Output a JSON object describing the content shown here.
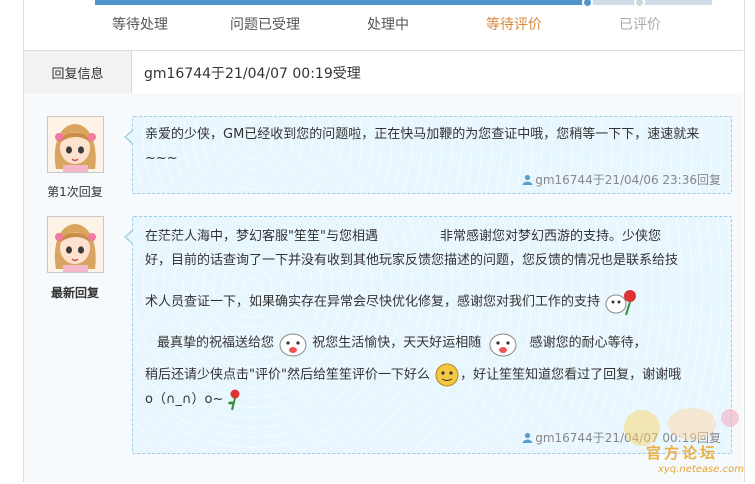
{
  "steps": [
    {
      "label": "等待处理",
      "state": "done"
    },
    {
      "label": "问题已受理",
      "state": "done"
    },
    {
      "label": "处理中",
      "state": "done"
    },
    {
      "label": "等待评价",
      "state": "current"
    },
    {
      "label": "已评价",
      "state": "todo"
    }
  ],
  "info": {
    "label": "回复信息",
    "value": "gm16744于21/04/07 00:19受理"
  },
  "replies": [
    {
      "avatar_label": "第1次回复",
      "text": "亲爱的少侠，GM已经收到您的问题啦，正在快马加鞭的为您查证中哦，您稍等一下下，速速就来~~~",
      "meta": "gm16744于21/04/06 23:36回复"
    },
    {
      "avatar_label": "最新回复",
      "line1a": "在茫茫人海中，梦幻客服\"笙笙\"与您相遇",
      "line1b": "非常感谢您对梦幻西游的支持。少侠您",
      "line2": "好，目前的话查询了一下并没有收到其他玩家反馈您描述的问题，您反馈的情况也是联系给技",
      "line3": "术人员查证一下，如果确实存在异常会尽快优化修复，感谢您对我们工作的支持",
      "line4a": "最真挚的祝福送给您",
      "line4b": "祝您生活愉快，天天好运相随",
      "line4c": "感谢您的耐心等待，",
      "line5a": "稍后还请少侠点击\"评价\"然后给笙笙评价一下好么",
      "line5b": "，好让笙笙知道您看过了回复，谢谢哦",
      "line6": "o（∩_∩）o~",
      "meta": "gm16744于21/04/07 00:19回复"
    }
  ],
  "watermark": {
    "site": "xyq.netease.com",
    "text": "官方论坛"
  },
  "colors": {
    "progress": "#4f93c8",
    "current_step": "#d9873a",
    "bubble_bg": "#e8f6fd",
    "bubble_border": "#9fcde6"
  },
  "icons": [
    "user-icon",
    "avatar-girl-icon",
    "rose-icon",
    "smiley-icon"
  ]
}
